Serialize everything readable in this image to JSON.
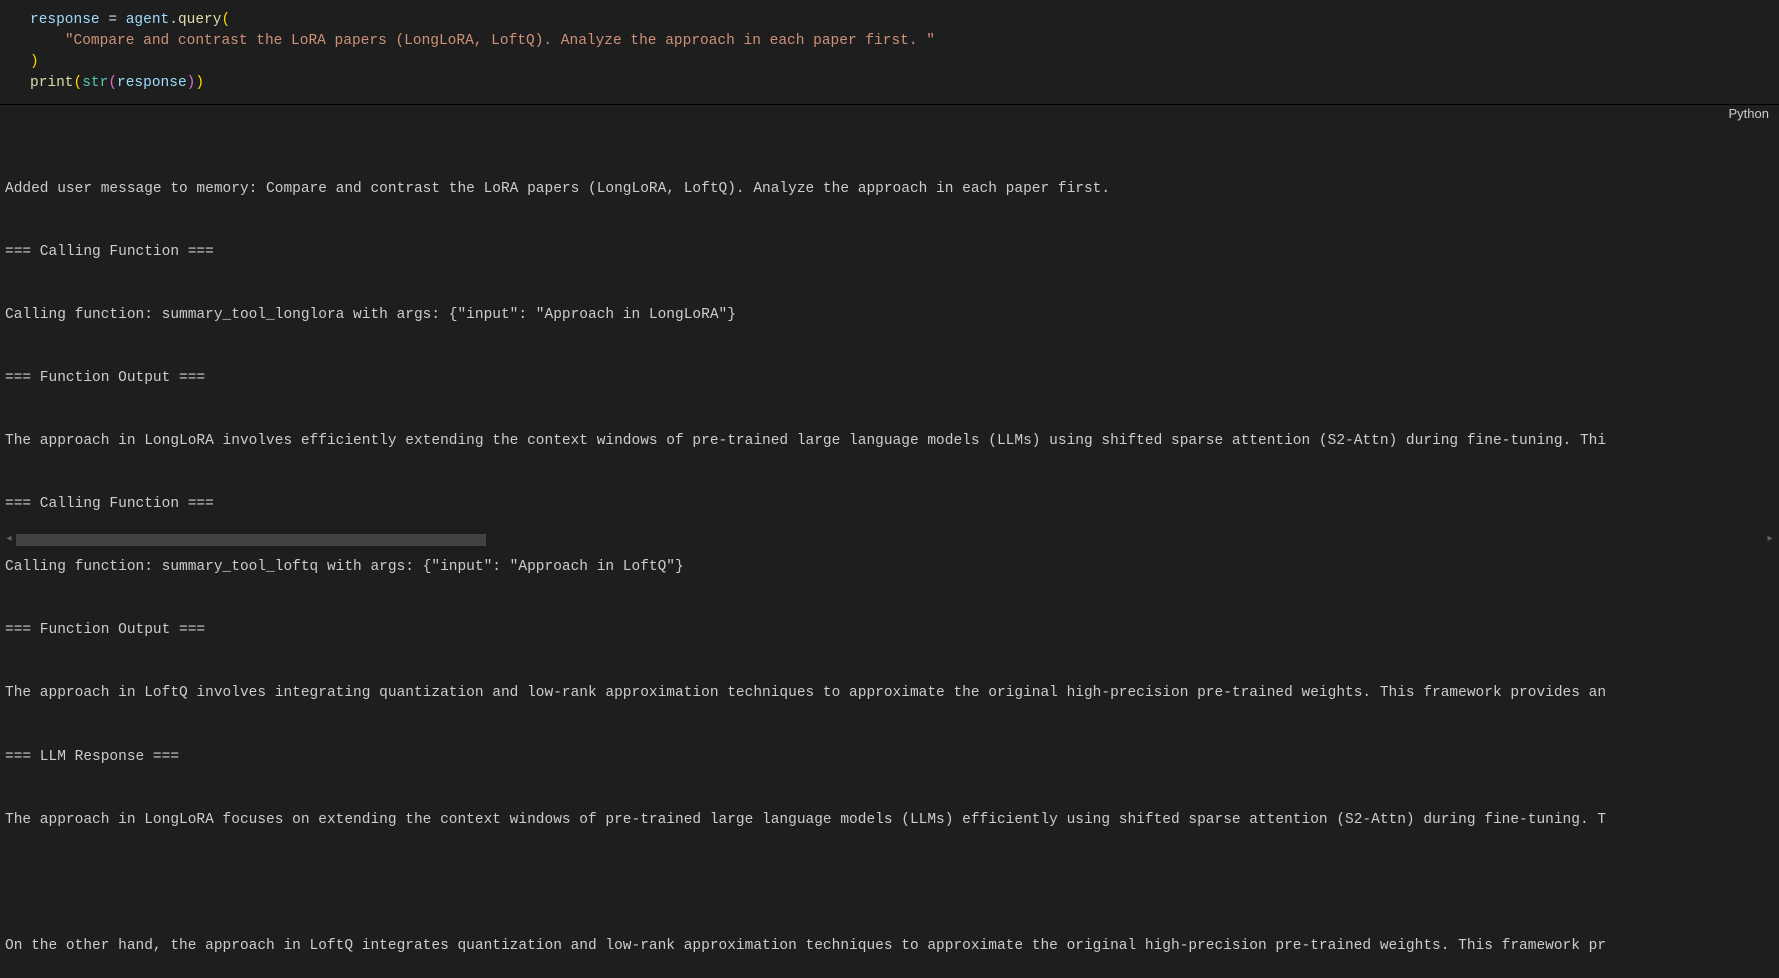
{
  "lang_label": "Python",
  "code": {
    "l1": {
      "a": "response",
      "b": " = ",
      "c": "agent",
      "d": ".",
      "e": "query",
      "f": "("
    },
    "l2": {
      "a": "    ",
      "b": "\"Compare and contrast the LoRA papers (LongLoRA, LoftQ). Analyze the approach in each paper first. \""
    },
    "l3": {
      "a": ")"
    },
    "l4": {
      "a": "print",
      "b": "(",
      "c": "str",
      "d": "(",
      "e": "response",
      "f": ")",
      "g": ")"
    }
  },
  "output": {
    "l1": "Added user message to memory: Compare and contrast the LoRA papers (LongLoRA, LoftQ). Analyze the approach in each paper first.",
    "l2": "=== Calling Function ===",
    "l3": "Calling function: summary_tool_longlora with args: {\"input\": \"Approach in LongLoRA\"}",
    "l4": "=== Function Output ===",
    "l5": "The approach in LongLoRA involves efficiently extending the context windows of pre-trained large language models (LLMs) using shifted sparse attention (S2-Attn) during fine-tuning. Thi",
    "l6": "=== Calling Function ===",
    "l7": "Calling function: summary_tool_loftq with args: {\"input\": \"Approach in LoftQ\"}",
    "l8": "=== Function Output ===",
    "l9": "The approach in LoftQ involves integrating quantization and low-rank approximation techniques to approximate the original high-precision pre-trained weights. This framework provides an",
    "l10": "=== LLM Response ===",
    "l11": "The approach in LongLoRA focuses on extending the context windows of pre-trained large language models (LLMs) efficiently using shifted sparse attention (S2-Attn) during fine-tuning. T",
    "l12": "",
    "l13": "On the other hand, the approach in LoftQ integrates quantization and low-rank approximation techniques to approximate the original high-precision pre-trained weights. This framework pr"
  }
}
